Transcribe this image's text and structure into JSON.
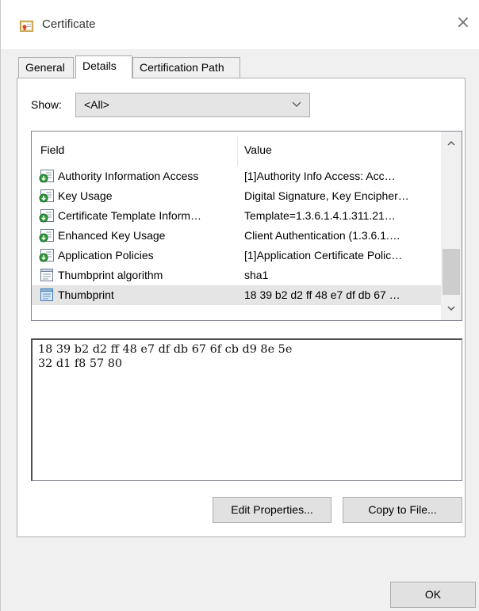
{
  "window": {
    "title": "Certificate",
    "close_glyph": "×"
  },
  "tabs": [
    {
      "label": "General",
      "active": false
    },
    {
      "label": "Details",
      "active": true
    },
    {
      "label": "Certification Path",
      "active": false
    }
  ],
  "show": {
    "label": "Show:",
    "selected": "<All>"
  },
  "list": {
    "columns": {
      "field": "Field",
      "value": "Value"
    },
    "rows": [
      {
        "field": "Authority Information Access",
        "value": "[1]Authority Info Access: Acc…",
        "icon": "certificate-extension-icon",
        "selected": false
      },
      {
        "field": "Key Usage",
        "value": "Digital Signature, Key Encipher…",
        "icon": "certificate-extension-icon",
        "selected": false
      },
      {
        "field": "Certificate Template Inform…",
        "value": "Template=1.3.6.1.4.1.311.21…",
        "icon": "certificate-extension-icon",
        "selected": false
      },
      {
        "field": "Enhanced Key Usage",
        "value": "Client Authentication (1.3.6.1.…",
        "icon": "certificate-extension-icon",
        "selected": false
      },
      {
        "field": "Application Policies",
        "value": "[1]Application Certificate Polic…",
        "icon": "certificate-extension-icon",
        "selected": false
      },
      {
        "field": "Thumbprint algorithm",
        "value": "sha1",
        "icon": "property-icon",
        "selected": false
      },
      {
        "field": "Thumbprint",
        "value": "18 39 b2 d2 ff 48 e7 df db 67 …",
        "icon": "property-icon",
        "selected": true
      }
    ]
  },
  "detail": {
    "text": "18 39 b2 d2 ff 48 e7 df db 67 6f cb d9 8e 5e\n32 d1 f8 57 80"
  },
  "buttons": {
    "edit_properties": "Edit Properties...",
    "copy_to_file": "Copy to File...",
    "ok": "OK"
  },
  "colors": {
    "selected_row": "#e5e5e5",
    "button_face": "#e1e1e1",
    "dialog_bg": "#f0f0f0"
  }
}
